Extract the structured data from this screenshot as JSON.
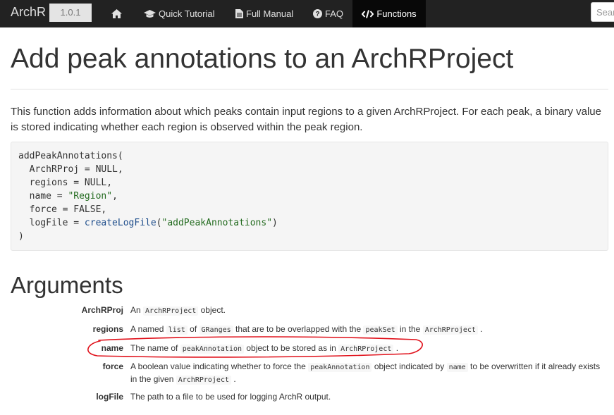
{
  "navbar": {
    "brand": "ArchR",
    "version": "1.0.1",
    "items": [
      {
        "label": "",
        "icon": "home-icon"
      },
      {
        "label": "Quick Tutorial",
        "icon": "graduation-cap-icon"
      },
      {
        "label": "Full Manual",
        "icon": "file-icon"
      },
      {
        "label": "FAQ",
        "icon": "question-circle-icon"
      },
      {
        "label": "Functions",
        "icon": "code-icon"
      }
    ],
    "search_placeholder": "Search"
  },
  "page": {
    "title": "Add peak annotations to an ArchRProject",
    "description": "This function adds information about which peaks contain input regions to a given ArchRProject. For each peak, a binary value is stored indicating whether each region is observed within the peak region.",
    "code": {
      "l1": "addPeakAnnotations(",
      "l2a": "  ArchRProj = NULL,",
      "l3a": "  regions = NULL,",
      "l4a": "  name = ",
      "l4b": "\"Region\"",
      "l4c": ",",
      "l5a": "  force = FALSE,",
      "l6a": "  logFile = ",
      "l6b": "createLogFile",
      "l6c": "(",
      "l6d": "\"addPeakAnnotations\"",
      "l6e": ")",
      "l7": ")"
    }
  },
  "arguments": {
    "heading": "Arguments",
    "archrproj": {
      "name": "ArchRProj",
      "t1": "An",
      "c1": "ArchRProject",
      "t2": "object."
    },
    "regions": {
      "name": "regions",
      "t1": "A named",
      "c1": "list",
      "t2": "of",
      "c2": "GRanges",
      "t3": "that are to be overlapped with the",
      "c3": "peakSet",
      "t4": "in the",
      "c4": "ArchRProject",
      "t5": "."
    },
    "name": {
      "name": "name",
      "t1": "The name of",
      "c1": "peakAnnotation",
      "t2": "object to be stored as in",
      "c2": "ArchRProject",
      "t3": "."
    },
    "force": {
      "name": "force",
      "t1": "A boolean value indicating whether to force the",
      "c1": "peakAnnotation",
      "t2": "object indicated by",
      "c2": "name",
      "t3": "to be overwritten if it already exists in the given",
      "c3": "ArchRProject",
      "t4": "."
    },
    "logfile": {
      "name": "logFile",
      "t1": "The path to a file to be used for logging ArchR output."
    }
  },
  "colors": {
    "navbar": "#222222",
    "annotation_ring": "#e0101a",
    "string": "#236b1f",
    "function": "#1f4e8c"
  }
}
